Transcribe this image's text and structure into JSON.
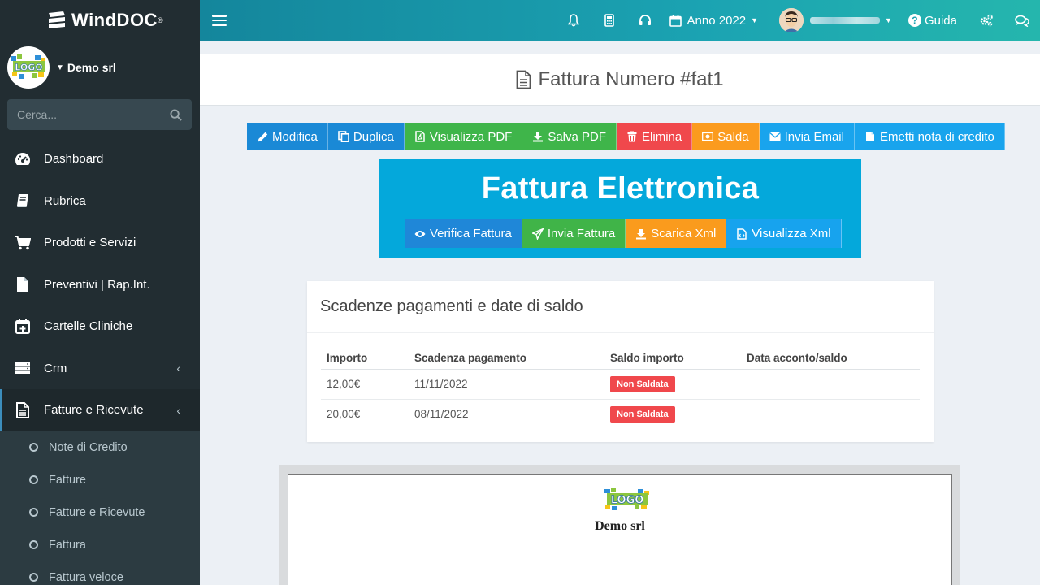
{
  "app": {
    "brand": "WindDOC",
    "brand_sup": "®",
    "company": "Demo srl",
    "logo_text": "LOGO"
  },
  "sidebar": {
    "search_placeholder": "Cerca...",
    "items": [
      {
        "label": "Dashboard",
        "icon": "dashboard-icon"
      },
      {
        "label": "Rubrica",
        "icon": "book-icon"
      },
      {
        "label": "Prodotti e Servizi",
        "icon": "cart-icon"
      },
      {
        "label": "Preventivi | Rap.Int.",
        "icon": "file-icon"
      },
      {
        "label": "Cartelle Cliniche",
        "icon": "calendar-plus-icon"
      },
      {
        "label": "Crm",
        "icon": "server-icon"
      },
      {
        "label": "Fatture e Ricevute",
        "icon": "file-text-icon"
      }
    ],
    "subitems": [
      "Note di Credito",
      "Fatture",
      "Fatture e Ricevute",
      "Fattura",
      "Fattura veloce"
    ]
  },
  "topbar": {
    "year_label": "Anno 2022",
    "help_label": "Guida"
  },
  "page": {
    "title": "Fattura Numero #fat1"
  },
  "actions": [
    {
      "label": "Modifica",
      "icon": "pencil-icon",
      "color": "#1a89d6"
    },
    {
      "label": "Duplica",
      "icon": "copy-icon",
      "color": "#1a89d6"
    },
    {
      "label": "Visualizza PDF",
      "icon": "file-pdf-icon",
      "color": "#3fb54a"
    },
    {
      "label": "Salva PDF",
      "icon": "download-icon",
      "color": "#3fb54a"
    },
    {
      "label": "Elimina",
      "icon": "trash-icon",
      "color": "#f0484c"
    },
    {
      "label": "Salda",
      "icon": "money-icon",
      "color": "#fb9b1e"
    },
    {
      "label": "Invia Email",
      "icon": "envelope-icon",
      "color": "#19a4ed"
    },
    {
      "label": "Emetti nota di credito",
      "icon": "file-icon",
      "color": "#19a4ed"
    }
  ],
  "fattura_elettronica": {
    "title": "Fattura Elettronica",
    "buttons": [
      {
        "label": "Verifica Fattura",
        "icon": "eye-icon"
      },
      {
        "label": "Invia Fattura",
        "icon": "paper-plane-icon"
      },
      {
        "label": "Scarica Xml",
        "icon": "download-icon"
      },
      {
        "label": "Visualizza Xml",
        "icon": "file-code-icon"
      }
    ]
  },
  "scadenze": {
    "title": "Scadenze pagamenti e date di saldo",
    "columns": [
      "Importo",
      "Scadenza pagamento",
      "Saldo importo",
      "Data acconto/saldo"
    ],
    "rows": [
      {
        "importo": "12,00€",
        "scadenza": "11/11/2022",
        "saldo": "Non Saldata",
        "data": ""
      },
      {
        "importo": "20,00€",
        "scadenza": "08/11/2022",
        "saldo": "Non Saldata",
        "data": ""
      }
    ]
  },
  "document_preview": {
    "company": "Demo srl"
  }
}
